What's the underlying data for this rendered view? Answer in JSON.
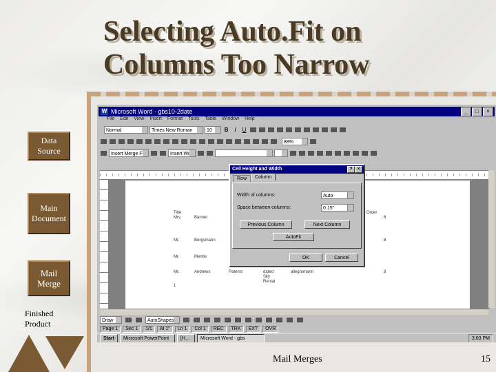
{
  "slide": {
    "title_line1": "Selecting Auto.Fit on",
    "title_line2": "Columns Too Narrow",
    "footer": "Mail Merges",
    "page_number": "15"
  },
  "nav": {
    "data_source": "Data Source",
    "main_document": "Main Document",
    "mail_merge": "Mail Merge",
    "finished_product": "Finished Product"
  },
  "word": {
    "title": "Microsoft Word - gbs10-2date",
    "menus": [
      "File",
      "Edit",
      "View",
      "Insert",
      "Format",
      "Tools",
      "Table",
      "Window",
      "Help"
    ],
    "style_value": "Normal",
    "font_value": "Times New Roman",
    "size_value": "10",
    "zoom_value": "88%",
    "merge_field_label": "Insert Merge Field",
    "word_field_label": "Insert Word Field",
    "table_cells": [
      "Title",
      "Mrs.",
      "Mr.",
      "Mr.",
      "Mr.",
      "Banner",
      "Bergsmann",
      "Mentle",
      "Andrews",
      "Patents",
      "dated",
      "Sky",
      "Rental",
      "allegromann",
      "1",
      "Order",
      "8",
      "8",
      "8"
    ],
    "draw_label": "Draw",
    "autoshapes_label": "AutoShapes",
    "status": [
      "Page 1",
      "Sec 1",
      "1/1",
      "At 1\"",
      "Ln 1",
      "Col 1",
      "REC",
      "TRK",
      "EXT",
      "OVR"
    ],
    "taskbar": {
      "start": "Start",
      "task1": "Microsoft PowerPoint",
      "task2": "[H...",
      "task3": "Microsoft Word - gbs",
      "clock": "3:03 PM"
    }
  },
  "dialog": {
    "title": "Cell Height and Width",
    "tab_row": "Row",
    "tab_column": "Column",
    "width_label": "Width of columns:",
    "width_value": "Auto",
    "space_label": "Space between columns:",
    "space_value": "0.15\"",
    "prev_column": "Previous Column",
    "next_column": "Next Column",
    "autofit": "AutoFit",
    "ok": "OK",
    "cancel": "Cancel"
  }
}
